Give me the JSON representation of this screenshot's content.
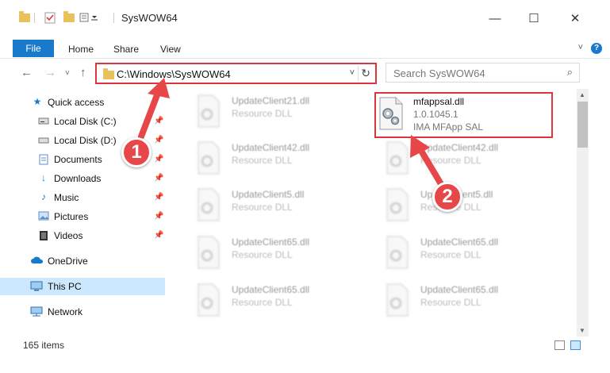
{
  "window": {
    "title": "SysWOW64",
    "minimize": "—",
    "maximize": "☐",
    "close": "✕"
  },
  "ribbon": {
    "tabs": [
      "File",
      "Home",
      "Share",
      "View"
    ],
    "expand": "˅",
    "help": "?"
  },
  "address": {
    "path": "C:\\Windows\\SysWOW64",
    "dropdown": "˅",
    "refresh": "↻"
  },
  "search": {
    "placeholder": "Search SysWOW64",
    "icon": "⌕"
  },
  "sidebar": {
    "items": [
      {
        "label": "Quick access",
        "icon": "star-icon",
        "pinned": false
      },
      {
        "label": "Local Disk (C:)",
        "icon": "drive-icon",
        "pinned": true
      },
      {
        "label": "Local Disk (D:)",
        "icon": "drive-icon",
        "pinned": true
      },
      {
        "label": "Documents",
        "icon": "document-icon",
        "pinned": true
      },
      {
        "label": "Downloads",
        "icon": "download-icon",
        "pinned": true
      },
      {
        "label": "Music",
        "icon": "music-icon",
        "pinned": true
      },
      {
        "label": "Pictures",
        "icon": "pictures-icon",
        "pinned": true
      },
      {
        "label": "Videos",
        "icon": "video-icon",
        "pinned": true
      },
      {
        "label": "OneDrive",
        "icon": "cloud-icon",
        "pinned": false
      },
      {
        "label": "This PC",
        "icon": "computer-icon",
        "pinned": false
      },
      {
        "label": "Network",
        "icon": "network-icon",
        "pinned": false
      }
    ]
  },
  "files": {
    "left_column": [
      {
        "name": "UpdateClient21.dll",
        "type": "Resource DLL"
      },
      {
        "name": "UpdateClient42.dll",
        "type": "Resource DLL"
      },
      {
        "name": "UpdateClient5.dll",
        "type": "Resource DLL"
      },
      {
        "name": "UpdateClient65.dll",
        "type": "Resource DLL"
      },
      {
        "name": "UpdateClient65.dll",
        "type": "Resource DLL"
      }
    ],
    "right_column": [
      {
        "name": "UpdateClient42.dll",
        "type": "Resource DLL"
      },
      {
        "name": "UpdateClient5.dll",
        "type": "Resource DLL"
      },
      {
        "name": "UpdateClient65.dll",
        "type": "Resource DLL"
      },
      {
        "name": "UpdateClient65.dll",
        "type": "Resource DLL"
      }
    ],
    "selected": {
      "name": "mfappsal.dll",
      "version": "1.0.1045.1",
      "company": "IMA MFApp SAL"
    }
  },
  "status": {
    "item_count": "165 items"
  },
  "callouts": [
    "1",
    "2"
  ],
  "colors": {
    "accent": "#1979ca",
    "highlight": "#d9373b",
    "selection": "#cce8ff",
    "callout": "#e8474a"
  }
}
